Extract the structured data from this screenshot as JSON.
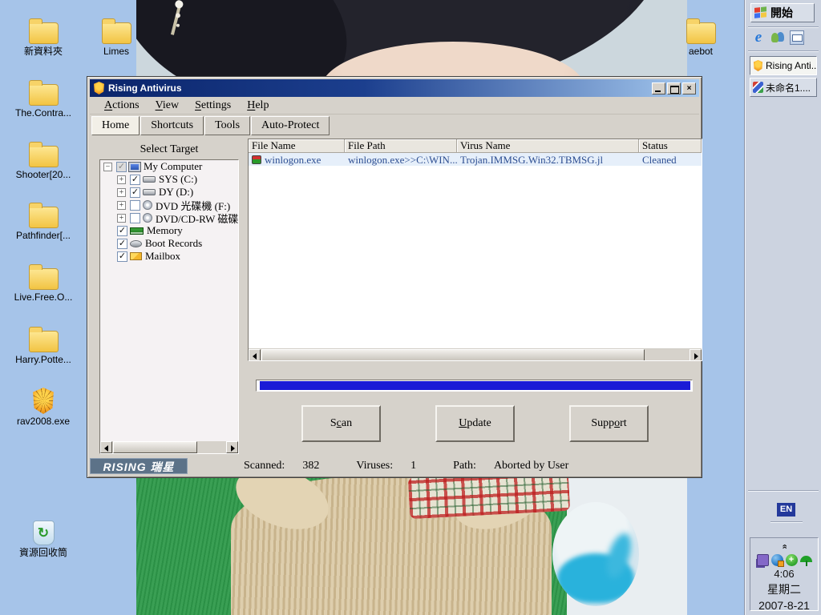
{
  "colors": {
    "desktop": "#a6c4e9",
    "title_bar_left": "#0a246a",
    "title_bar_right": "#a6caf0",
    "progress_fill": "#1b1bd6",
    "selected_row_bg": "#e6effa",
    "selected_row_text": "#2e4f92",
    "taskbar": "#ccd3e0",
    "logo_bg": "#5c7288"
  },
  "desktop": {
    "icons": [
      {
        "label": "新資料夾",
        "type": "folder"
      },
      {
        "label": "Limes",
        "type": "folder"
      },
      {
        "label": "The.Contra...",
        "type": "folder"
      },
      {
        "label": "Shooter[20...",
        "type": "folder"
      },
      {
        "label": "Pathfinder[...",
        "type": "folder"
      },
      {
        "label": "Live.Free.O...",
        "type": "folder"
      },
      {
        "label": "Harry.Potte...",
        "type": "folder"
      },
      {
        "label": "rav2008.exe",
        "type": "rising"
      },
      {
        "label": "資源回收筒",
        "type": "recycle"
      },
      {
        "label": "aebot",
        "type": "folder"
      }
    ]
  },
  "taskbar": {
    "start_label": "開始",
    "quick_launch": [
      {
        "icon": "ie"
      },
      {
        "icon": "msn"
      },
      {
        "icon": "oe"
      }
    ],
    "tasks": [
      {
        "label": "Rising Anti...",
        "active": true
      },
      {
        "label": "未命名1....",
        "active": false
      }
    ],
    "language_indicator": "EN",
    "tray_icons": [
      {
        "icon": "puzzle"
      },
      {
        "icon": "globe"
      },
      {
        "icon": "gplus"
      },
      {
        "icon": "umb"
      }
    ],
    "clock": {
      "time": "4:06",
      "weekday": "星期二",
      "date": "2007-8-21"
    }
  },
  "window": {
    "title": "Rising Antivirus",
    "menus": [
      {
        "pre": "",
        "u": "A",
        "post": "ctions"
      },
      {
        "pre": "",
        "u": "V",
        "post": "iew"
      },
      {
        "pre": "",
        "u": "S",
        "post": "ettings"
      },
      {
        "pre": "",
        "u": "H",
        "post": "elp"
      }
    ],
    "tabs": [
      {
        "label": "Home",
        "active": true
      },
      {
        "label": "Shortcuts",
        "active": false
      },
      {
        "label": "Tools",
        "active": false
      },
      {
        "label": "Auto-Protect",
        "active": false
      }
    ],
    "select_target_label": "Select Target",
    "tree": [
      {
        "label": "My Computer",
        "checked": "partial",
        "expand": "minus",
        "icon": "computer",
        "indent": 0
      },
      {
        "label": "SYS (C:)",
        "checked": true,
        "expand": "plus",
        "icon": "drive",
        "indent": 1
      },
      {
        "label": "DY (D:)",
        "checked": true,
        "expand": "plus",
        "icon": "drive",
        "indent": 1
      },
      {
        "label": "DVD 光碟機 (F:)",
        "checked": false,
        "expand": "plus",
        "icon": "cd",
        "indent": 1
      },
      {
        "label": "DVD/CD-RW 磁碟機",
        "checked": false,
        "expand": "plus",
        "icon": "cd",
        "indent": 1
      },
      {
        "label": "Memory",
        "checked": true,
        "expand": null,
        "icon": "memory",
        "indent": 1
      },
      {
        "label": "Boot Records",
        "checked": true,
        "expand": null,
        "icon": "boot",
        "indent": 1
      },
      {
        "label": "Mailbox",
        "checked": true,
        "expand": null,
        "icon": "mail",
        "indent": 1
      }
    ],
    "list": {
      "columns": [
        "File Name",
        "File Path",
        "Virus Name",
        "Status"
      ],
      "rows": [
        {
          "file_name": "winlogon.exe",
          "file_path": "winlogon.exe>>C:\\WIN...",
          "virus_name": "Trojan.IMMSG.Win32.TBMSG.jl",
          "status": "Cleaned"
        }
      ]
    },
    "buttons": [
      {
        "pre": "S",
        "u": "c",
        "post": "an"
      },
      {
        "pre": "",
        "u": "U",
        "post": "pdate"
      },
      {
        "pre": "Supp",
        "u": "o",
        "post": "rt"
      }
    ],
    "logo": "RISING 瑞星",
    "status": {
      "scanned_label": "Scanned:",
      "scanned_value": "382",
      "viruses_label": "Viruses:",
      "viruses_value": "1",
      "path_label": "Path:",
      "path_value": "Aborted by User"
    }
  }
}
